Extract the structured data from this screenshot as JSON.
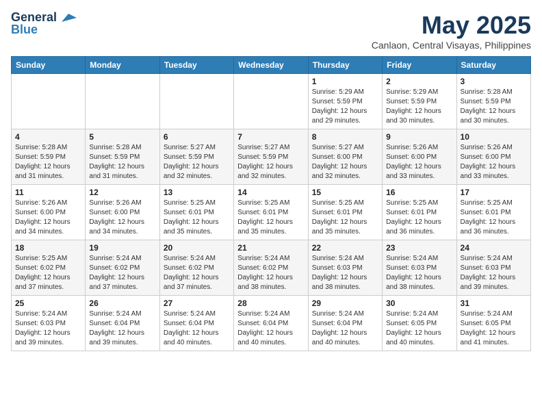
{
  "header": {
    "logo_line1": "General",
    "logo_line2": "Blue",
    "month_title": "May 2025",
    "location": "Canlaon, Central Visayas, Philippines"
  },
  "weekdays": [
    "Sunday",
    "Monday",
    "Tuesday",
    "Wednesday",
    "Thursday",
    "Friday",
    "Saturday"
  ],
  "weeks": [
    [
      {
        "day": "",
        "info": ""
      },
      {
        "day": "",
        "info": ""
      },
      {
        "day": "",
        "info": ""
      },
      {
        "day": "",
        "info": ""
      },
      {
        "day": "1",
        "info": "Sunrise: 5:29 AM\nSunset: 5:59 PM\nDaylight: 12 hours\nand 29 minutes."
      },
      {
        "day": "2",
        "info": "Sunrise: 5:29 AM\nSunset: 5:59 PM\nDaylight: 12 hours\nand 30 minutes."
      },
      {
        "day": "3",
        "info": "Sunrise: 5:28 AM\nSunset: 5:59 PM\nDaylight: 12 hours\nand 30 minutes."
      }
    ],
    [
      {
        "day": "4",
        "info": "Sunrise: 5:28 AM\nSunset: 5:59 PM\nDaylight: 12 hours\nand 31 minutes."
      },
      {
        "day": "5",
        "info": "Sunrise: 5:28 AM\nSunset: 5:59 PM\nDaylight: 12 hours\nand 31 minutes."
      },
      {
        "day": "6",
        "info": "Sunrise: 5:27 AM\nSunset: 5:59 PM\nDaylight: 12 hours\nand 32 minutes."
      },
      {
        "day": "7",
        "info": "Sunrise: 5:27 AM\nSunset: 5:59 PM\nDaylight: 12 hours\nand 32 minutes."
      },
      {
        "day": "8",
        "info": "Sunrise: 5:27 AM\nSunset: 6:00 PM\nDaylight: 12 hours\nand 32 minutes."
      },
      {
        "day": "9",
        "info": "Sunrise: 5:26 AM\nSunset: 6:00 PM\nDaylight: 12 hours\nand 33 minutes."
      },
      {
        "day": "10",
        "info": "Sunrise: 5:26 AM\nSunset: 6:00 PM\nDaylight: 12 hours\nand 33 minutes."
      }
    ],
    [
      {
        "day": "11",
        "info": "Sunrise: 5:26 AM\nSunset: 6:00 PM\nDaylight: 12 hours\nand 34 minutes."
      },
      {
        "day": "12",
        "info": "Sunrise: 5:26 AM\nSunset: 6:00 PM\nDaylight: 12 hours\nand 34 minutes."
      },
      {
        "day": "13",
        "info": "Sunrise: 5:25 AM\nSunset: 6:01 PM\nDaylight: 12 hours\nand 35 minutes."
      },
      {
        "day": "14",
        "info": "Sunrise: 5:25 AM\nSunset: 6:01 PM\nDaylight: 12 hours\nand 35 minutes."
      },
      {
        "day": "15",
        "info": "Sunrise: 5:25 AM\nSunset: 6:01 PM\nDaylight: 12 hours\nand 35 minutes."
      },
      {
        "day": "16",
        "info": "Sunrise: 5:25 AM\nSunset: 6:01 PM\nDaylight: 12 hours\nand 36 minutes."
      },
      {
        "day": "17",
        "info": "Sunrise: 5:25 AM\nSunset: 6:01 PM\nDaylight: 12 hours\nand 36 minutes."
      }
    ],
    [
      {
        "day": "18",
        "info": "Sunrise: 5:25 AM\nSunset: 6:02 PM\nDaylight: 12 hours\nand 37 minutes."
      },
      {
        "day": "19",
        "info": "Sunrise: 5:24 AM\nSunset: 6:02 PM\nDaylight: 12 hours\nand 37 minutes."
      },
      {
        "day": "20",
        "info": "Sunrise: 5:24 AM\nSunset: 6:02 PM\nDaylight: 12 hours\nand 37 minutes."
      },
      {
        "day": "21",
        "info": "Sunrise: 5:24 AM\nSunset: 6:02 PM\nDaylight: 12 hours\nand 38 minutes."
      },
      {
        "day": "22",
        "info": "Sunrise: 5:24 AM\nSunset: 6:03 PM\nDaylight: 12 hours\nand 38 minutes."
      },
      {
        "day": "23",
        "info": "Sunrise: 5:24 AM\nSunset: 6:03 PM\nDaylight: 12 hours\nand 38 minutes."
      },
      {
        "day": "24",
        "info": "Sunrise: 5:24 AM\nSunset: 6:03 PM\nDaylight: 12 hours\nand 39 minutes."
      }
    ],
    [
      {
        "day": "25",
        "info": "Sunrise: 5:24 AM\nSunset: 6:03 PM\nDaylight: 12 hours\nand 39 minutes."
      },
      {
        "day": "26",
        "info": "Sunrise: 5:24 AM\nSunset: 6:04 PM\nDaylight: 12 hours\nand 39 minutes."
      },
      {
        "day": "27",
        "info": "Sunrise: 5:24 AM\nSunset: 6:04 PM\nDaylight: 12 hours\nand 40 minutes."
      },
      {
        "day": "28",
        "info": "Sunrise: 5:24 AM\nSunset: 6:04 PM\nDaylight: 12 hours\nand 40 minutes."
      },
      {
        "day": "29",
        "info": "Sunrise: 5:24 AM\nSunset: 6:04 PM\nDaylight: 12 hours\nand 40 minutes."
      },
      {
        "day": "30",
        "info": "Sunrise: 5:24 AM\nSunset: 6:05 PM\nDaylight: 12 hours\nand 40 minutes."
      },
      {
        "day": "31",
        "info": "Sunrise: 5:24 AM\nSunset: 6:05 PM\nDaylight: 12 hours\nand 41 minutes."
      }
    ]
  ]
}
